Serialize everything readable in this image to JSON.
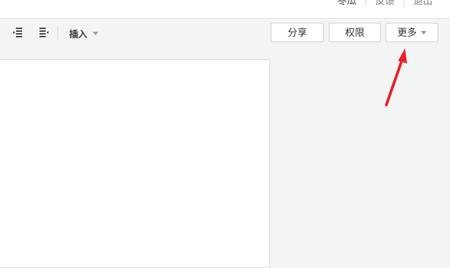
{
  "header": {
    "user_name": "冬瓜",
    "feedback_label": "反馈",
    "logout_label": "退出"
  },
  "toolbar": {
    "icons": [
      "indent-decrease-icon",
      "indent-increase-icon"
    ],
    "insert_label": "插入",
    "share_label": "分享",
    "permissions_label": "权限",
    "more_label": "更多"
  },
  "annotation": {
    "arrow_color": "#e8212a"
  },
  "colors": {
    "background": "#f3f4f4",
    "page": "#ffffff",
    "button_border": "#cfcfcf"
  }
}
